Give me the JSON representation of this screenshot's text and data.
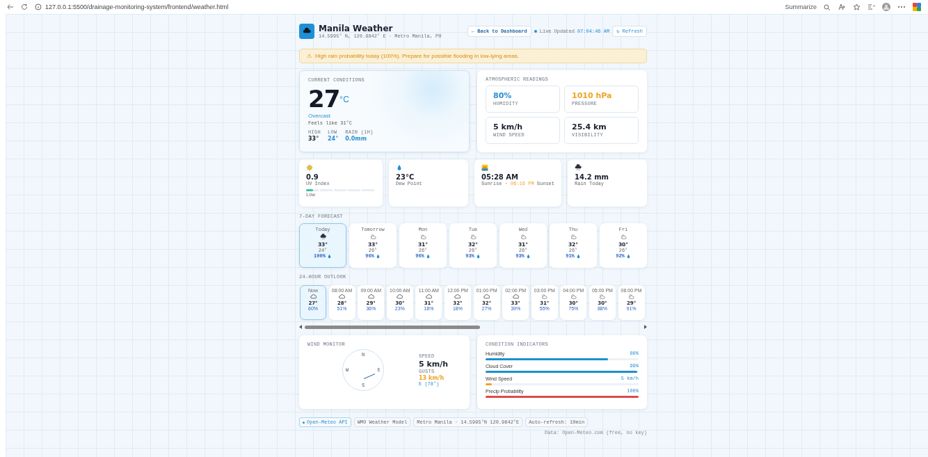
{
  "browser": {
    "url": "127.0.0.1:5500/drainage-monitoring-system/frontend/weather.html",
    "summarize": "Summarize"
  },
  "header": {
    "title": "Manila Weather",
    "subtitle": "14.5995° N, 120.9842° E · Metro Manila, PH",
    "back": "← Back to Dashboard",
    "live": "Live",
    "updated_label": "Updated",
    "updated_time": "07:04:46 AM",
    "refresh": "↻ Refresh"
  },
  "alert": {
    "icon": "⚠",
    "text": "High rain probability today (100%). Prepare for possible flooding in low-lying areas."
  },
  "current": {
    "title": "CURRENT CONDITIONS",
    "temp": "27",
    "unit": "°C",
    "condition": "Overcast",
    "feels": "Feels like 31°C",
    "stats": [
      {
        "label": "HIGH",
        "value": "33°",
        "kind": "high"
      },
      {
        "label": "LOW",
        "value": "24°",
        "kind": "low"
      },
      {
        "label": "RAIN (1H)",
        "value": "0.0mm",
        "kind": "rain"
      }
    ]
  },
  "atmospheric": {
    "title": "ATMOSPHERIC READINGS",
    "readings": [
      {
        "value": "80%",
        "label": "HUMIDITY",
        "color": "#2b8fd2"
      },
      {
        "value": "1010 hPa",
        "label": "PRESSURE",
        "color": "#f0a325"
      },
      {
        "value": "5 km/h",
        "label": "WIND SPEED",
        "color": "#1b2030"
      },
      {
        "value": "25.4 km",
        "label": "VISIBILITY",
        "color": "#1b2030"
      }
    ]
  },
  "cards": [
    {
      "kind": "uv",
      "value": "0.9",
      "label": "UV Index",
      "level": 0.1,
      "scale": "Low"
    },
    {
      "kind": "dew",
      "value": "23°C",
      "label": "Dew Point"
    },
    {
      "kind": "sun",
      "value": "05:28 AM",
      "label": "Sunrise · ",
      "sunset": "06:16 PM",
      "label_end": " Sunset"
    },
    {
      "kind": "rain",
      "value": "14.2 mm",
      "label": "Rain Today"
    }
  ],
  "forecast": {
    "title": "7-DAY FORECAST",
    "days": [
      {
        "day": "Today",
        "kind": "rain",
        "high": "33°",
        "low": "24°",
        "precip": "100%",
        "selected": true
      },
      {
        "day": "Tomorrow",
        "kind": "partly",
        "high": "33°",
        "low": "26°",
        "precip": "96%",
        "selected": false
      },
      {
        "day": "Mon",
        "kind": "partly",
        "high": "31°",
        "low": "26°",
        "precip": "96%",
        "selected": false
      },
      {
        "day": "Tue",
        "kind": "partly",
        "high": "32°",
        "low": "26°",
        "precip": "93%",
        "selected": false
      },
      {
        "day": "Wed",
        "kind": "partly",
        "high": "31°",
        "low": "26°",
        "precip": "93%",
        "selected": false
      },
      {
        "day": "Thu",
        "kind": "partly",
        "high": "32°",
        "low": "26°",
        "precip": "91%",
        "selected": false
      },
      {
        "day": "Fri",
        "kind": "partly",
        "high": "30°",
        "low": "26°",
        "precip": "92%",
        "selected": false
      }
    ]
  },
  "hourly": {
    "title": "24-HOUR OUTLOOK",
    "hours": [
      {
        "time": "Now",
        "kind": "cloud",
        "temp": "27°",
        "precip": "60%",
        "selected": true
      },
      {
        "time": "08:00 AM",
        "kind": "cloud",
        "temp": "28°",
        "precip": "51%",
        "selected": false
      },
      {
        "time": "09:00 AM",
        "kind": "cloud",
        "temp": "29°",
        "precip": "36%",
        "selected": false
      },
      {
        "time": "10:00 AM",
        "kind": "cloud",
        "temp": "30°",
        "precip": "23%",
        "selected": false
      },
      {
        "time": "11:00 AM",
        "kind": "cloud",
        "temp": "31°",
        "precip": "18%",
        "selected": false
      },
      {
        "time": "12:00 PM",
        "kind": "cloud",
        "temp": "32°",
        "precip": "18%",
        "selected": false
      },
      {
        "time": "01:00 PM",
        "kind": "cloud",
        "temp": "32°",
        "precip": "27%",
        "selected": false
      },
      {
        "time": "02:00 PM",
        "kind": "cloud",
        "temp": "33°",
        "precip": "39%",
        "selected": false
      },
      {
        "time": "03:00 PM",
        "kind": "partly",
        "temp": "31°",
        "precip": "55%",
        "selected": false
      },
      {
        "time": "04:00 PM",
        "kind": "partly",
        "temp": "30°",
        "precip": "75%",
        "selected": false
      },
      {
        "time": "05:00 PM",
        "kind": "partly",
        "temp": "30°",
        "precip": "88%",
        "selected": false
      },
      {
        "time": "06:00 PM",
        "kind": "partly",
        "temp": "29°",
        "precip": "91%",
        "selected": false
      }
    ]
  },
  "wind": {
    "title": "WIND MONITOR",
    "compass": [
      "N",
      "E",
      "S",
      "W"
    ],
    "speed_label": "SPEED",
    "speed": "5 km/h",
    "gusts_label": "GUSTS",
    "gusts": "13 km/h",
    "direction": "E (78°)"
  },
  "conditions": {
    "title": "CONDITION INDICATORS",
    "items": [
      {
        "label": "Humidity",
        "value": "80%",
        "level": 0.8,
        "color": "#1b8fd0"
      },
      {
        "label": "Cloud Cover",
        "value": "99%",
        "level": 0.99,
        "color": "#1b8fd0"
      },
      {
        "label": "Wind Speed",
        "value": "5 km/h",
        "level": 0.04,
        "color": "#f0a325"
      },
      {
        "label": "Precip Probability",
        "value": "100%",
        "level": 1,
        "color": "#e0484a"
      }
    ]
  },
  "footer": {
    "tags": [
      {
        "text": "Open-Meteo API",
        "kind": "accent"
      },
      {
        "text": "WMO Weather Model",
        "kind": "plain"
      },
      {
        "text": "Metro Manila · 14.5995°N 120.9842°E",
        "kind": "plain"
      },
      {
        "text": "Auto-refresh: 10min",
        "kind": "plain"
      }
    ],
    "credit": "Data: Open-Meteo.com (free, no key)"
  }
}
